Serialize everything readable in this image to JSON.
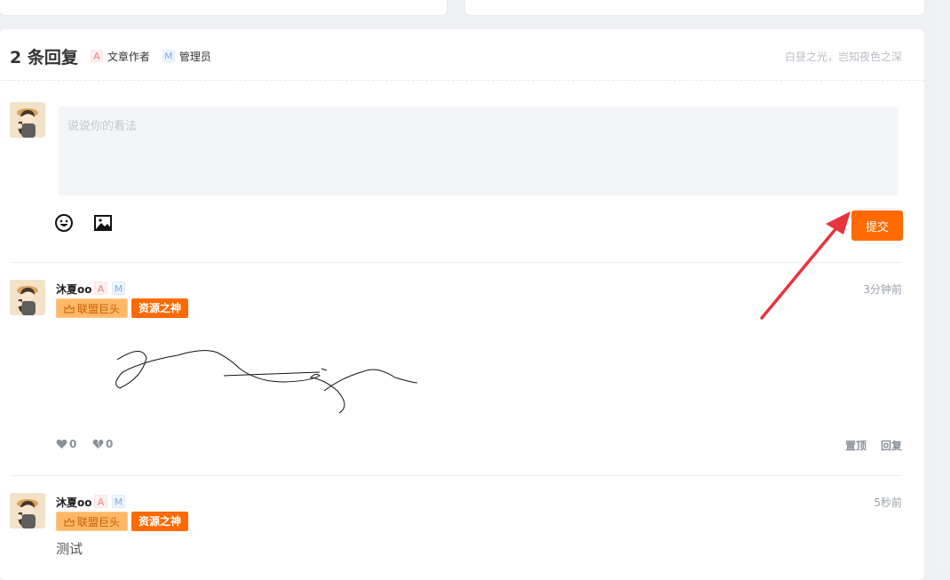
{
  "header": {
    "title": "2 条回复",
    "legend": [
      {
        "tag": "A",
        "label": "文章作者"
      },
      {
        "tag": "M",
        "label": "管理员"
      }
    ],
    "motto": "白昼之光，岂知夜色之深"
  },
  "editor": {
    "placeholder": "说说你的看法",
    "tools": [
      "emoji-icon",
      "image-icon"
    ],
    "submit_label": "提交"
  },
  "comments": [
    {
      "name": "沐夏oo",
      "tags": [
        "A",
        "M"
      ],
      "badges": [
        "联盟巨头",
        "资源之神"
      ],
      "time": "3分钟前",
      "content_type": "handwritten-image",
      "likes": "0",
      "dislikes": "0",
      "actions": [
        "置顶",
        "回复"
      ]
    },
    {
      "name": "沐夏oo",
      "tags": [
        "A",
        "M"
      ],
      "badges": [
        "联盟巨头",
        "资源之神"
      ],
      "time": "5秒前",
      "content": "测试"
    }
  ],
  "colors": {
    "accent": "#ff6a00",
    "annotation_arrow": "#e8343c",
    "badge_gold": "#ffb866"
  }
}
